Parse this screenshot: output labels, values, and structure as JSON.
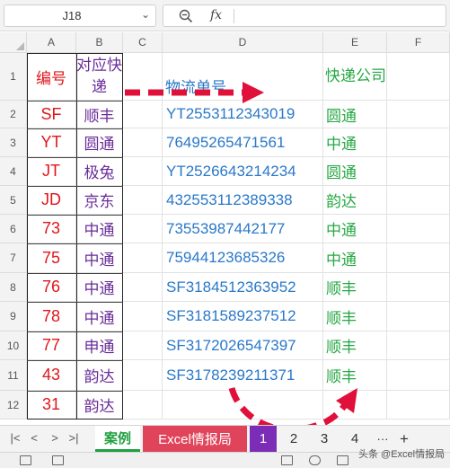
{
  "formula_bar": {
    "name_box": "J18",
    "fx": "fx",
    "formula": ""
  },
  "columns": [
    "A",
    "B",
    "C",
    "D",
    "E",
    "F"
  ],
  "rows": [
    "1",
    "2",
    "3",
    "4",
    "5",
    "6",
    "7",
    "8",
    "9",
    "10",
    "11",
    "12"
  ],
  "headers": {
    "a": "编号",
    "b": "对应快递",
    "d": "物流单号",
    "e": "快递公司"
  },
  "table": [
    {
      "a": "SF",
      "b": "顺丰",
      "d": "YT2553112343019",
      "e": "圆通",
      "flag": false
    },
    {
      "a": "YT",
      "b": "圆通",
      "d": "76495265471561",
      "e": "中通",
      "flag": true
    },
    {
      "a": "JT",
      "b": "极兔",
      "d": "YT2526643214234",
      "e": "圆通",
      "flag": false
    },
    {
      "a": "JD",
      "b": "京东",
      "d": "432553112389338",
      "e": "韵达",
      "flag": true
    },
    {
      "a": "73",
      "b": "中通",
      "d": "73553987442177",
      "e": "中通",
      "flag": true
    },
    {
      "a": "75",
      "b": "中通",
      "d": "75944123685326",
      "e": "中通",
      "flag": true
    },
    {
      "a": "76",
      "b": "中通",
      "d": "SF3184512363952",
      "e": "顺丰",
      "flag": false
    },
    {
      "a": "78",
      "b": "中通",
      "d": "SF3181589237512",
      "e": "顺丰",
      "flag": false
    },
    {
      "a": "77",
      "b": "申通",
      "d": "SF3172026547397",
      "e": "顺丰",
      "flag": false
    },
    {
      "a": "43",
      "b": "韵达",
      "d": "SF3178239211371",
      "e": "顺丰",
      "flag": false
    },
    {
      "a": "31",
      "b": "韵达",
      "d": "",
      "e": "",
      "flag": false
    }
  ],
  "tabs": [
    "案例",
    "Excel情报局",
    "1",
    "2",
    "3",
    "4"
  ],
  "tab_nav": [
    "|<",
    "<",
    ">",
    ">|"
  ],
  "tab_more": "···",
  "tab_add": "+",
  "watermark": "头条 @Excel情报局",
  "colors": {
    "arrow": "#e0103a",
    "id": "#e0151b",
    "courier": "#6a2c9a",
    "tracking": "#2a78c8",
    "company": "#27a844"
  }
}
